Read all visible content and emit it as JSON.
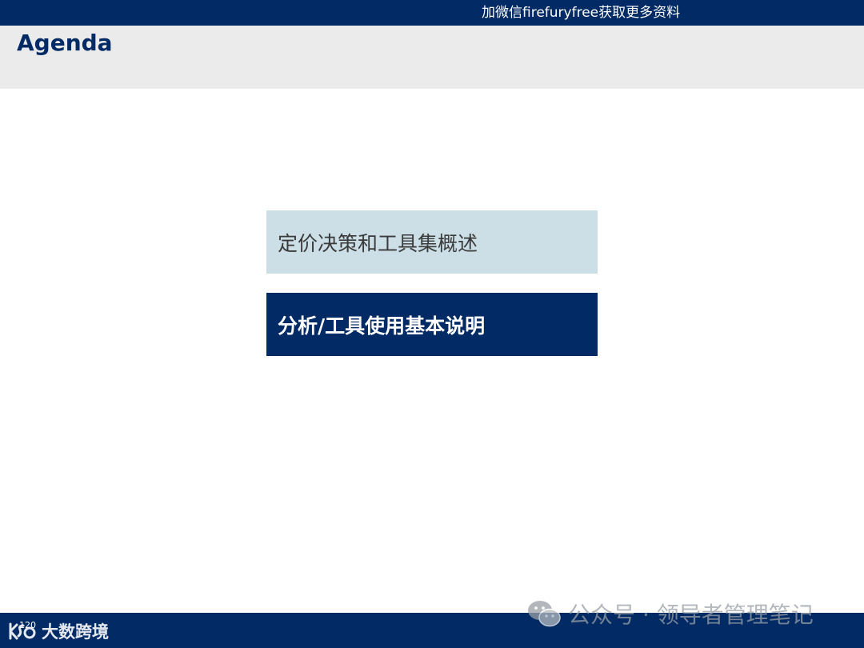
{
  "promo_banner": {
    "text": "加微信firefuryfree获取更多资料"
  },
  "slide": {
    "title": "Agenda",
    "agenda_items": [
      {
        "label": "定价决策和工具集概述",
        "state": "inactive"
      },
      {
        "label": "分析/工具使用基本说明",
        "state": "active"
      }
    ],
    "page_number": "120"
  },
  "footer": {
    "logo_text": "大数跨境",
    "logo_icon": "brand-logo-icon"
  },
  "watermark": {
    "icon": "wechat-icon",
    "text": "公众号 · 领导者管理笔记"
  },
  "colors": {
    "navy": "#022a64",
    "header_gray": "#ebebeb",
    "inactive_item_bg": "#ccdfe6"
  }
}
